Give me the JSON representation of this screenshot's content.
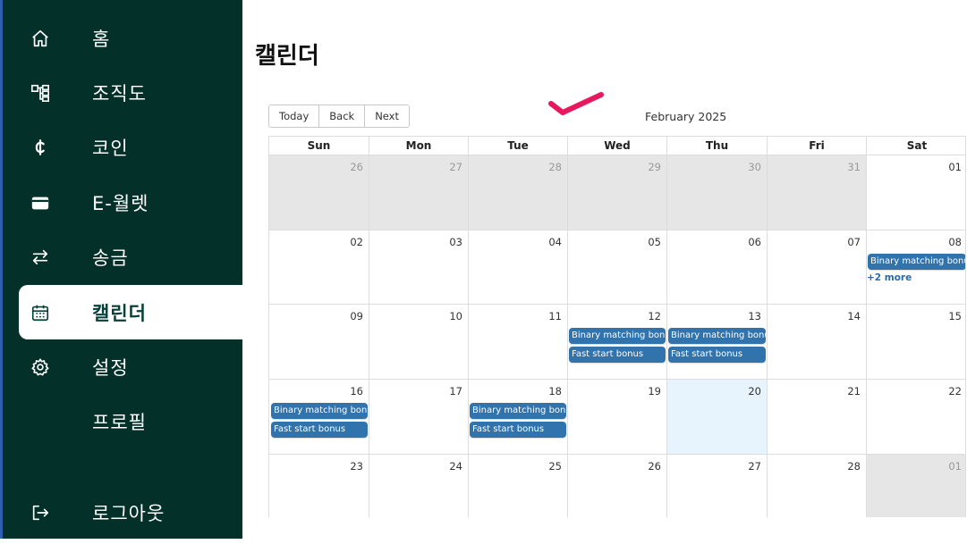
{
  "sidebar": {
    "items": [
      {
        "label": "홈",
        "icon": "home-icon",
        "active": false
      },
      {
        "label": "조직도",
        "icon": "org-chart-icon",
        "active": false
      },
      {
        "label": "코인",
        "icon": "coin-icon",
        "active": false
      },
      {
        "label": "E-월렛",
        "icon": "wallet-icon",
        "active": false
      },
      {
        "label": "송금",
        "icon": "transfer-icon",
        "active": false
      },
      {
        "label": "캘린더",
        "icon": "calendar-icon",
        "active": true
      },
      {
        "label": "설정",
        "icon": "gear-icon",
        "active": false
      },
      {
        "label": "프로필",
        "icon": "",
        "active": false
      },
      {
        "label": "로그아웃",
        "icon": "logout-icon",
        "active": false
      }
    ],
    "background": "#04302a",
    "active_text_color": "#05413a"
  },
  "page": {
    "title": "캘린더"
  },
  "toolbar": {
    "today_label": "Today",
    "back_label": "Back",
    "next_label": "Next"
  },
  "calendar": {
    "month_label": "February 2025",
    "day_headers": [
      "Sun",
      "Mon",
      "Tue",
      "Wed",
      "Thu",
      "Fri",
      "Sat"
    ],
    "weeks": [
      [
        {
          "day": "26",
          "off": true
        },
        {
          "day": "27",
          "off": true
        },
        {
          "day": "28",
          "off": true
        },
        {
          "day": "29",
          "off": true
        },
        {
          "day": "30",
          "off": true
        },
        {
          "day": "31",
          "off": true
        },
        {
          "day": "01",
          "off": false
        }
      ],
      [
        {
          "day": "02",
          "off": false
        },
        {
          "day": "03",
          "off": false
        },
        {
          "day": "04",
          "off": false
        },
        {
          "day": "05",
          "off": false
        },
        {
          "day": "06",
          "off": false
        },
        {
          "day": "07",
          "off": false
        },
        {
          "day": "08",
          "off": false
        }
      ],
      [
        {
          "day": "09",
          "off": false
        },
        {
          "day": "10",
          "off": false
        },
        {
          "day": "11",
          "off": false
        },
        {
          "day": "12",
          "off": false
        },
        {
          "day": "13",
          "off": false
        },
        {
          "day": "14",
          "off": false
        },
        {
          "day": "15",
          "off": false
        }
      ],
      [
        {
          "day": "16",
          "off": false
        },
        {
          "day": "17",
          "off": false
        },
        {
          "day": "18",
          "off": false
        },
        {
          "day": "19",
          "off": false
        },
        {
          "day": "20",
          "off": false,
          "today": true
        },
        {
          "day": "21",
          "off": false
        },
        {
          "day": "22",
          "off": false
        }
      ],
      [
        {
          "day": "23",
          "off": false
        },
        {
          "day": "24",
          "off": false
        },
        {
          "day": "25",
          "off": false
        },
        {
          "day": "26",
          "off": false
        },
        {
          "day": "27",
          "off": false
        },
        {
          "day": "28",
          "off": false
        },
        {
          "day": "01",
          "off": true
        }
      ]
    ],
    "events": [
      {
        "week": 1,
        "col": 6,
        "slot": 0,
        "title": "Binary matching bonus"
      },
      {
        "week": 2,
        "col": 3,
        "slot": 0,
        "title": "Binary matching bonus"
      },
      {
        "week": 2,
        "col": 3,
        "slot": 1,
        "title": "Fast start bonus"
      },
      {
        "week": 2,
        "col": 4,
        "slot": 0,
        "title": "Binary matching bonus"
      },
      {
        "week": 2,
        "col": 4,
        "slot": 1,
        "title": "Fast start bonus"
      },
      {
        "week": 3,
        "col": 0,
        "slot": 0,
        "title": "Binary matching bonus"
      },
      {
        "week": 3,
        "col": 0,
        "slot": 1,
        "title": "Fast start bonus"
      },
      {
        "week": 3,
        "col": 2,
        "slot": 0,
        "title": "Binary matching bonus"
      },
      {
        "week": 3,
        "col": 2,
        "slot": 1,
        "title": "Fast start bonus"
      }
    ],
    "more_links": [
      {
        "week": 1,
        "col": 6,
        "slot": 1,
        "label": "+2 more"
      }
    ],
    "event_color": "#3173ad",
    "off_day_color": "#e6e6e6",
    "today_color": "#e8f4fd"
  },
  "annotation": {
    "color": "#e8185f"
  }
}
